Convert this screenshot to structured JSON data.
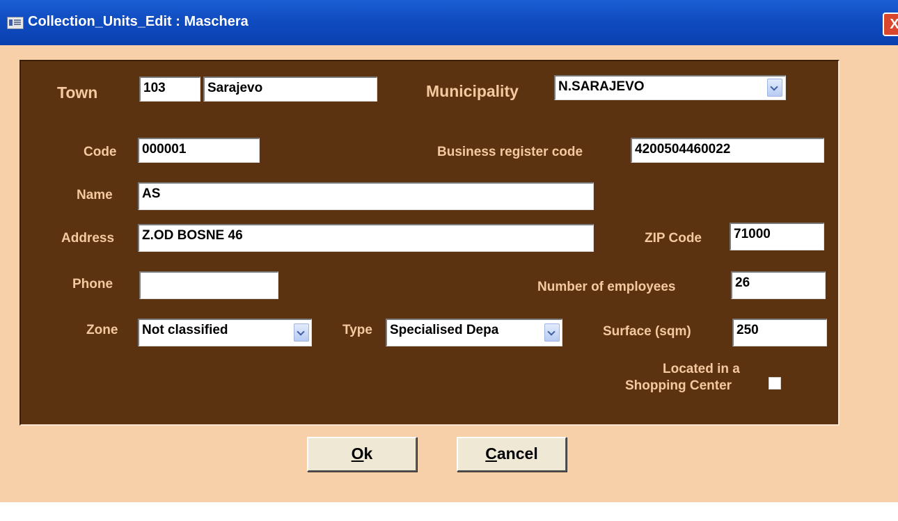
{
  "window": {
    "title": "Collection_Units_Edit : Maschera",
    "close_glyph": "X"
  },
  "form": {
    "town": {
      "label": "Town",
      "code": "103",
      "name": "Sarajevo"
    },
    "municipality": {
      "label": "Municipality",
      "value": "N.SARAJEVO"
    },
    "code": {
      "label": "Code",
      "value": "000001"
    },
    "business_register_code": {
      "label": "Business register code",
      "value": "4200504460022"
    },
    "name": {
      "label": "Name",
      "value": "AS"
    },
    "address": {
      "label": "Address",
      "value": "Z.OD BOSNE 46"
    },
    "zip_code": {
      "label": "ZIP Code",
      "value": "71000"
    },
    "phone": {
      "label": "Phone",
      "value": ""
    },
    "number_of_employees": {
      "label": "Number of employees",
      "value": "26"
    },
    "zone": {
      "label": "Zone",
      "value": "Not classified"
    },
    "type": {
      "label": "Type",
      "value": "Specialised Depa"
    },
    "surface": {
      "label": "Surface (sqm)",
      "value": "250"
    },
    "shopping_center": {
      "label_line1": "Located in a",
      "label_line2": "Shopping Center",
      "checked": false
    }
  },
  "buttons": {
    "ok": {
      "accel": "O",
      "rest": "k"
    },
    "cancel": {
      "accel": "C",
      "rest": "ancel"
    }
  },
  "colors": {
    "background": "#f7cfa9",
    "panel": "#5c3311",
    "label": "#f4c9a0",
    "titlebar": "#0f4cc0"
  },
  "icons": [
    "form-icon",
    "close-icon",
    "chevron-down-icon"
  ]
}
